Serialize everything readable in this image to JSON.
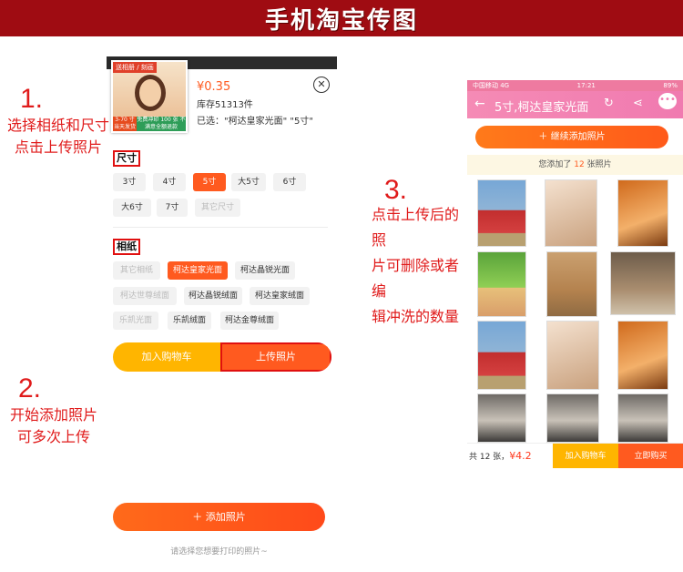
{
  "banner": {
    "title": "手机淘宝传图"
  },
  "steps": [
    {
      "num": "1.",
      "lines": [
        "选择相纸和尺寸",
        "点击上传照片"
      ]
    },
    {
      "num": "2.",
      "lines": [
        "开始添加照片",
        "可多次上传"
      ]
    },
    {
      "num": "3.",
      "lines": [
        "点击上传后的照",
        "片可删除或者编",
        "辑冲洗的数量"
      ]
    }
  ],
  "product": {
    "thumb_tag": "送相册 / 刻画",
    "thumb_badge_left": "3-70 寸 当天发货",
    "thumb_badge_right": "免费冲印 100 张 不满意全额退款",
    "price": "¥0.35",
    "stock": "库存51313件",
    "selected": "已选：\"柯达皇家光面\" \"5寸\""
  },
  "size": {
    "label": "尺寸",
    "options": [
      "3寸",
      "4寸",
      "5寸",
      "大5寸",
      "6寸",
      "大6寸",
      "7寸",
      "其它尺寸"
    ],
    "selected": "5寸"
  },
  "paper": {
    "label": "相纸",
    "options": [
      "其它相纸",
      "柯达皇家光面",
      "柯达晶锐光面",
      "柯达世尊绒面",
      "柯达晶锐绒面",
      "柯达皇家绒面",
      "乐凯光面",
      "乐凯绒面",
      "柯达金尊绒面"
    ],
    "selected": "柯达皇家光面"
  },
  "actions": {
    "add_cart": "加入购物车",
    "upload": "上传照片",
    "add_photo": "＋ 添加照片",
    "hint": "请选择您想要打印的照片~"
  },
  "upload_page": {
    "status_left": "中国移动 4G",
    "status_time": "17:21",
    "status_right": "89%",
    "title": "5寸,柯达皇家光面",
    "continue_add": "＋ 继续添加照片",
    "added_prefix": "您添加了 ",
    "added_count": "12",
    "added_suffix": " 张照片",
    "total_prefix": "共 12 张，",
    "total_amount": "¥4.2",
    "add_cart": "加入购物车",
    "buy_now": "立即购买"
  },
  "colors": {
    "brand": "#ff5a1f",
    "banner": "#9f0c12",
    "highlight": "#e01010",
    "cart": "#ffb500"
  },
  "icons": {
    "close": "close-icon",
    "back": "back-arrow-icon",
    "refresh": "refresh-icon",
    "share": "share-icon",
    "more": "chat-bubble-icon"
  }
}
